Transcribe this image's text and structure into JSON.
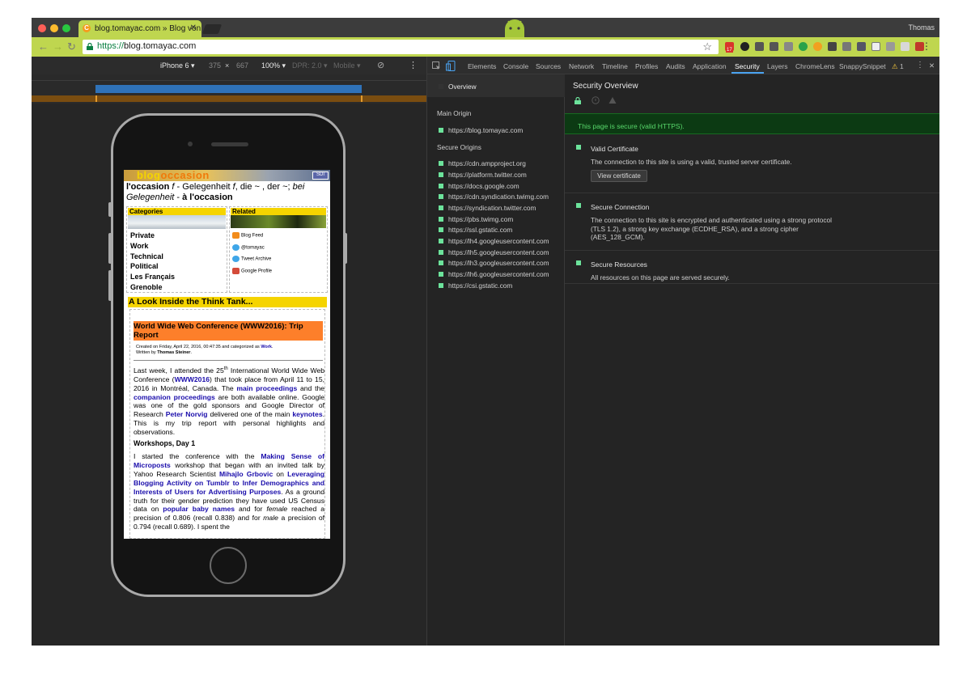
{
  "browser": {
    "tab_title": "blog.tomayac.com » Blog von",
    "tab_close": "✕",
    "favicon": "C",
    "user_name": "Thomas",
    "url_scheme": "https://",
    "url_host": "blog.tomayac.com",
    "back_icon": "←",
    "forward_icon": "→",
    "reload_icon": "↻",
    "star_icon": "☆",
    "menu_icon": "⋮",
    "ext_badge": "17",
    "accent": "#bfd64f"
  },
  "device": {
    "model": "iPhone 6",
    "width": "375",
    "times": "×",
    "height": "667",
    "zoom": "100%",
    "dpr": "DPR: 2.0",
    "mode": "Mobile",
    "more_icon": "⋮"
  },
  "blog": {
    "logo_a": "blog",
    "logo_b": "occasion",
    "nav_label": "SDI",
    "tagline_word": "l'occasion",
    "tagline_f": "f",
    "tagline_de": " - Gelegenheit ",
    "tagline_f2": "f",
    "tagline_die": ", die ~ , der ~; ",
    "tagline_bei": "bei Gelegenheit",
    "tagline_dash": " - ",
    "tagline_fr": "à l'occasion",
    "categories_label": "Categories",
    "related_label": "Related",
    "categories": [
      "Private",
      "Work",
      "Technical",
      "Political",
      "Les Français",
      "Grenoble"
    ],
    "related": [
      "Blog Feed",
      "@tomayac",
      "Tweet Archive",
      "Google Profile"
    ],
    "think_tank": "A Look Inside the Think Tank...",
    "post_title": "World Wide Web Conference (WWW2016): Trip Report",
    "meta_created": "Created on Friday, April 22, 2016, 00:47:35 and categorized as ",
    "meta_cat": "Work",
    "meta_dot": ".",
    "meta_written": "Written by ",
    "meta_author": "Thomas Steiner",
    "meta_end": ".",
    "para1": {
      "t1": "Last week, I attended the 25",
      "sup": "th",
      "t2": " International World Wide Web Conference (",
      "l1": "WWW2016",
      "t3": ") that took place from April 11 to 15, 2016 in Montréal, Canada. The ",
      "l2": "main proceedings",
      "t4": " and the ",
      "l3": "companion proceedings",
      "t5": " are both available online. Google was one of the gold sponsors and Google Director of Research ",
      "l4": "Peter Norvig",
      "t6": " delivered one of the main ",
      "l5": "keynotes",
      "t7": ". This is my trip report with personal highlights and observations."
    },
    "subhead": "Workshops, Day 1",
    "para2": {
      "t1": "I started the conference with the ",
      "l1": "Making Sense of Microposts",
      "t2": " workshop that began with an invited talk by Yahoo Research Scientist ",
      "l2": "Mihajlo Grbovic",
      "t3": " on ",
      "l3": "Leveraging Blogging Activity on Tumblr to Infer Demographics and Interests of Users for Advertising Purposes",
      "t4": ". As a ground truth for their gender prediction they have used US Census data on ",
      "l4": "popular baby names",
      "t5": " and for ",
      "i1": "female",
      "t6": " reached a precision of 0.806 (recall 0.838) and for ",
      "i2": "male",
      "t7": " a precision of 0.794 (recall 0.689). I spent the"
    }
  },
  "devtools": {
    "tabs": [
      "Elements",
      "Console",
      "Sources",
      "Network",
      "Timeline",
      "Profiles",
      "Audits",
      "Application",
      "Security",
      "Layers",
      "ChromeLens",
      "SnappySnippet"
    ],
    "active_tab": "Security",
    "warning_count": "1",
    "warning_icon": "⚠",
    "close_icon": "✕",
    "menu_icon": "⋮",
    "sidebar": {
      "overview": "Overview",
      "main_origin_label": "Main Origin",
      "main_origin": "https://blog.tomayac.com",
      "secure_origins_label": "Secure Origins",
      "secure_origins": [
        "https://cdn.ampproject.org",
        "https://platform.twitter.com",
        "https://docs.google.com",
        "https://cdn.syndication.twimg.com",
        "https://syndication.twitter.com",
        "https://pbs.twimg.com",
        "https://ssl.gstatic.com",
        "https://lh4.googleusercontent.com",
        "https://lh5.googleusercontent.com",
        "https://lh3.googleusercontent.com",
        "https://lh6.googleusercontent.com",
        "https://csi.gstatic.com"
      ]
    },
    "security": {
      "title": "Security Overview",
      "banner": "This page is secure (valid HTTPS).",
      "cert_title": "Valid Certificate",
      "cert_desc": "The connection to this site is using a valid, trusted server certificate.",
      "cert_button": "View certificate",
      "conn_title": "Secure Connection",
      "conn_desc": "The connection to this site is encrypted and authenticated using a strong protocol (TLS 1.2), a strong key exchange (ECDHE_RSA), and a strong cipher (AES_128_GCM).",
      "res_title": "Secure Resources",
      "res_desc": "All resources on this page are served securely.",
      "secure_color": "#6ce39b"
    }
  }
}
